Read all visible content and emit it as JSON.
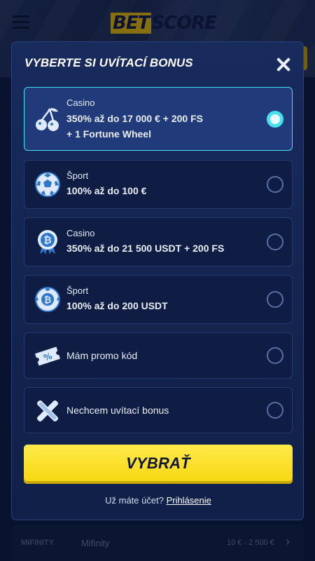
{
  "header": {
    "logo_part1": "BET",
    "logo_part2": "SCORE"
  },
  "modal": {
    "title": "VYBERTE SI UVÍTACÍ BONUS",
    "close_label": "×",
    "options": [
      {
        "category": "Casino",
        "line1": "350% až do 17 000 € + 200 FS",
        "line2": "+ 1 Fortune Wheel",
        "icon": "cherries-icon",
        "selected": true
      },
      {
        "category": "Šport",
        "line1": "100% až do 100 €",
        "icon": "soccer-ball-icon",
        "selected": false
      },
      {
        "category": "Casino",
        "line1": "350% až do 21 500 USDT + 200 FS",
        "icon": "bitcoin-badge-icon",
        "selected": false
      },
      {
        "category": "Šport",
        "line1": "100% až do 200 USDT",
        "icon": "bitcoin-ball-icon",
        "selected": false
      },
      {
        "label": "Mám promo kód",
        "icon": "promo-ticket-icon",
        "selected": false
      },
      {
        "label": "Nechcem uvítací bonus",
        "icon": "no-bonus-x-icon",
        "selected": false
      }
    ],
    "cta_label": "VYBRAŤ",
    "login_prompt": "Už máte účet?",
    "login_link": "Prihlásenie"
  },
  "background_row": {
    "logo_text": "MIFINITY",
    "name": "Mifinity",
    "range": "10 € - 2 500 €"
  },
  "colors": {
    "accent_cyan": "#47e0f0",
    "cta_yellow": "#f6d70f",
    "modal_bg": "#132450"
  }
}
